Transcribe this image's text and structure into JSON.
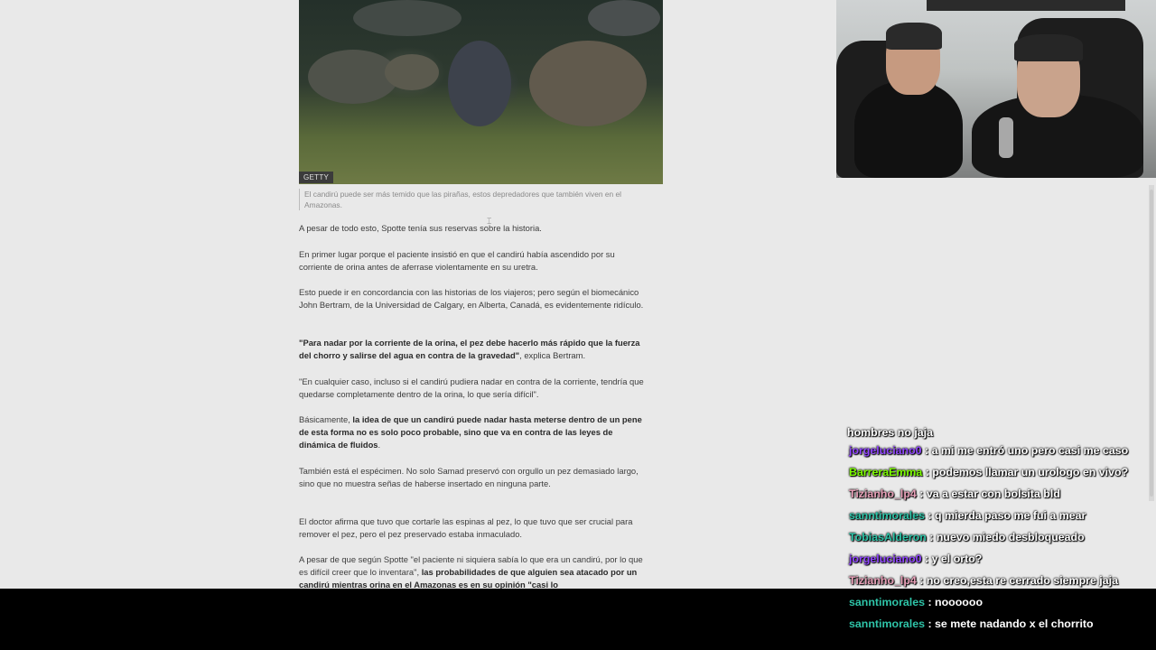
{
  "article": {
    "photo_credit": "GETTY",
    "caption": "El candirú puede ser más temido que las pirañas, estos depredadores que también viven en el Amazonas.",
    "paragraphs": [
      {
        "plain": "A pesar de todo esto, Spotte tenía sus reservas sobre la historia."
      },
      {
        "plain": "En primer lugar porque el paciente insistió en que el candirú había ascendido por su corriente de orina antes de aferrase violentamente en su uretra."
      },
      {
        "plain": "Esto puede ir en concordancia con las historias de los viajeros; pero según el biomecánico John Bertram, de la Universidad de Calgary, en Alberta, Canadá, es evidentemente ridículo."
      },
      {
        "bold": "\"Para nadar por la corriente de la orina, el pez debe hacerlo más rápido que la fuerza del chorro y salirse del agua en contra de la gravedad\"",
        "after": ", explica Bertram."
      },
      {
        "plain": "\"En cualquier caso, incluso si el candirú pudiera nadar en contra de la corriente, tendría que quedarse completamente dentro de la orina, lo que sería difícil\"."
      },
      {
        "before": "Básicamente, ",
        "bold": "la idea de que un candirú puede nadar hasta meterse dentro de un pene de esta forma no es solo poco probable, sino que va en contra de las leyes de dinámica de fluidos",
        "after": "."
      },
      {
        "plain": "También está el espécimen. No solo Samad preservó con orgullo un pez demasiado largo, sino que no muestra señas de haberse insertado en ninguna parte."
      },
      {
        "plain": "El doctor afirma que tuvo que cortarle las espinas al pez, lo que tuvo que ser crucial para remover el pez, pero el pez preservado estaba inmaculado."
      },
      {
        "before": "A pesar de que según Spotte \"el paciente ni siquiera sabía lo que era un candirú, por lo que es difícil creer que lo inventara\", ",
        "bold": "las probabilidades de que alguien sea atacado por un candirú mientras orina en el Amazonas es en su opinión \"casi lo"
      }
    ]
  },
  "chat": {
    "partial_top": "hombres no jaja",
    "messages": [
      {
        "user": "jorgeluciano0",
        "color": "#9146ff",
        "text": "a mi me entró uno pero casi me caso"
      },
      {
        "user": "BarreraEmma",
        "color": "#7cfc00",
        "text": "podemos llamar un urologo en vivo?"
      },
      {
        "user": "Tizianho_lp4",
        "color": "#e8a0b8",
        "text": "va a estar con bolsita bld"
      },
      {
        "user": "sanntimorales",
        "color": "#2ec4a8",
        "text": "q mierda paso me fui a mear"
      },
      {
        "user": "TobiasAlderon",
        "color": "#2ec4a8",
        "text": "nuevo miedo desbloqueado"
      },
      {
        "user": "jorgeluciano0",
        "color": "#9146ff",
        "text": "y el orto?"
      },
      {
        "user": "Tizianho_lp4",
        "color": "#e8a0b8",
        "text": "no creo,esta re cerrado siempre jaja"
      },
      {
        "user": "sanntimorales",
        "color": "#2ec4a8",
        "text": "noooooo"
      },
      {
        "user": "sanntimorales",
        "color": "#2ec4a8",
        "text": "se mete nadando x el chorrito"
      }
    ],
    "separator": " : "
  }
}
